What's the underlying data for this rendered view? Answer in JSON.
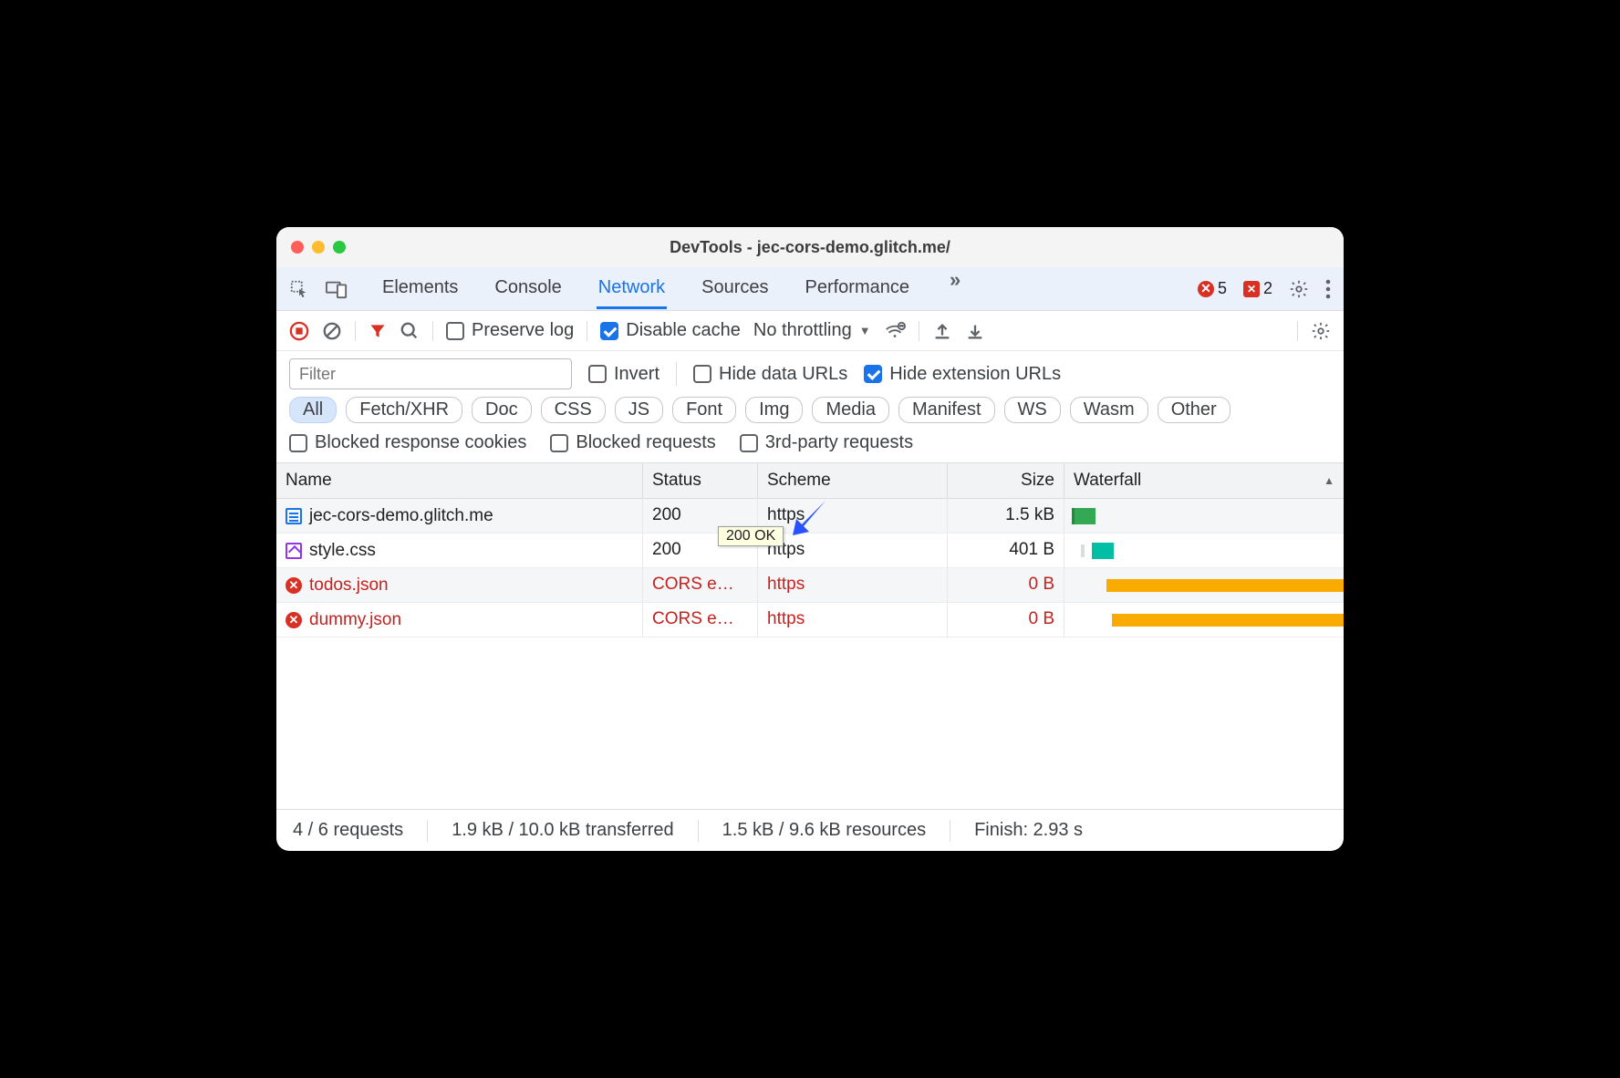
{
  "window": {
    "title": "DevTools - jec-cors-demo.glitch.me/"
  },
  "tabs": {
    "items": [
      "Elements",
      "Console",
      "Network",
      "Sources",
      "Performance"
    ],
    "active_index": 2,
    "overflow_glyph": "»"
  },
  "badges": {
    "errors": "5",
    "issue_count": "2"
  },
  "toolbar": {
    "preserve_log": "Preserve log",
    "disable_cache": "Disable cache",
    "throttling": "No throttling"
  },
  "filter": {
    "placeholder": "Filter",
    "invert": "Invert",
    "hide_data_urls": "Hide data URLs",
    "hide_ext_urls": "Hide extension URLs"
  },
  "pills": [
    "All",
    "Fetch/XHR",
    "Doc",
    "CSS",
    "JS",
    "Font",
    "Img",
    "Media",
    "Manifest",
    "WS",
    "Wasm",
    "Other"
  ],
  "checks2": {
    "blocked_cookies": "Blocked response cookies",
    "blocked_requests": "Blocked requests",
    "third_party": "3rd-party requests"
  },
  "columns": {
    "name": "Name",
    "status": "Status",
    "scheme": "Scheme",
    "size": "Size",
    "waterfall": "Waterfall"
  },
  "rows": [
    {
      "name": "jec-cors-demo.glitch.me",
      "status": "200",
      "scheme": "https",
      "size": "1.5 kB",
      "error": false,
      "icon": "doc"
    },
    {
      "name": "style.css",
      "status": "200",
      "scheme": "https",
      "size": "401 B",
      "error": false,
      "icon": "css"
    },
    {
      "name": "todos.json",
      "status": "CORS e…",
      "scheme": "https",
      "size": "0 B",
      "error": true,
      "icon": "err"
    },
    {
      "name": "dummy.json",
      "status": "CORS e…",
      "scheme": "https",
      "size": "0 B",
      "error": true,
      "icon": "err"
    }
  ],
  "tooltip": "200 OK",
  "statusbar": {
    "requests": "4 / 6 requests",
    "transferred": "1.9 kB / 10.0 kB transferred",
    "resources": "1.5 kB / 9.6 kB resources",
    "finish": "Finish: 2.93 s"
  }
}
